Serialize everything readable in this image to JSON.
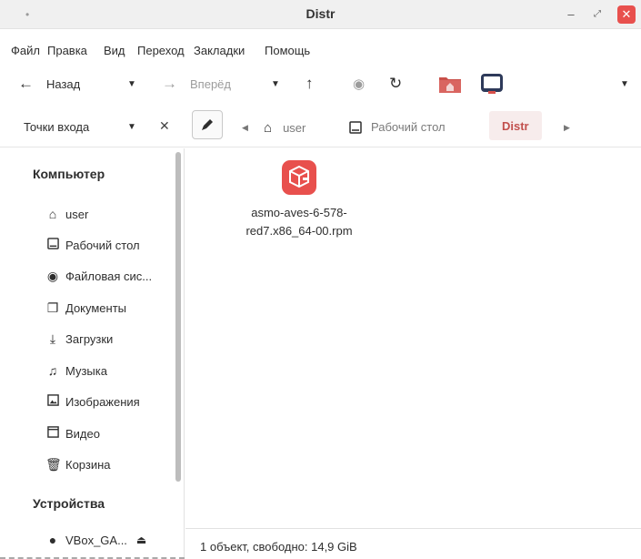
{
  "window": {
    "title": "Distr",
    "minimize_glyph": "–",
    "maximize_glyph": "⤢",
    "close_glyph": "✕"
  },
  "menu": [
    "Файл",
    "Правка",
    "Вид",
    "Переход",
    "Закладки",
    "Помощь"
  ],
  "toolbar": {
    "back_label": "Назад",
    "forward_label": "Вперёд",
    "forward_disabled": true
  },
  "sidebar_header": {
    "label": "Точки входа"
  },
  "breadcrumb": [
    {
      "label": "user",
      "icon": "home-icon"
    },
    {
      "label": "Рабочий стол",
      "icon": "desktop-icon"
    },
    {
      "label": "Distr",
      "active": true
    }
  ],
  "sidebar": {
    "computer_heading": "Компьютер",
    "items": [
      {
        "label": "user",
        "icon": "home-icon"
      },
      {
        "label": "Рабочий стол",
        "icon": "desktop-icon"
      },
      {
        "label": "Файловая сис...",
        "icon": "filesystem-icon"
      },
      {
        "label": "Документы",
        "icon": "documents-icon"
      },
      {
        "label": "Загрузки",
        "icon": "downloads-icon"
      },
      {
        "label": "Музыка",
        "icon": "music-icon"
      },
      {
        "label": "Изображения",
        "icon": "pictures-icon"
      },
      {
        "label": "Видео",
        "icon": "video-icon"
      },
      {
        "label": "Корзина",
        "icon": "trash-icon"
      }
    ],
    "devices_heading": "Устройства",
    "devices": [
      {
        "label": "VBox_GA...",
        "icon": "disc-icon",
        "action_icon": "eject-icon"
      }
    ]
  },
  "files": [
    {
      "name_line1": "asmo-aves-6-578-",
      "name_line2": "red7.x86_64-00.rpm",
      "icon": "rpm-package-icon",
      "icon_color": "#e8504d"
    }
  ],
  "status": {
    "text": "1 объект, свободно: 14,9 GiB"
  },
  "colors": {
    "accent": "#c2504d",
    "close_button": "#e8504d",
    "package_icon": "#e8504d"
  }
}
